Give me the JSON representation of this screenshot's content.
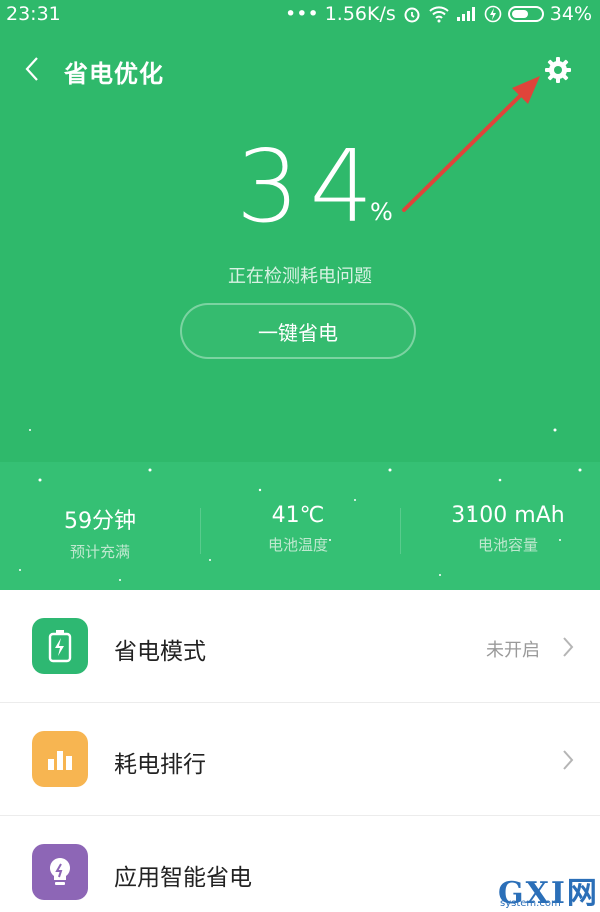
{
  "status_bar": {
    "time": "23:31",
    "speed": "••• 1.56K/s",
    "battery_text": "34%"
  },
  "header": {
    "title": "省电优化",
    "back_icon": "chevron-left-icon",
    "settings_icon": "gear-icon"
  },
  "battery": {
    "percent": "34",
    "percent_sign": "%",
    "detect_text": "正在检测耗电问题",
    "save_button": "一键省电"
  },
  "stats": [
    {
      "value": "59分钟",
      "label": "预计充满"
    },
    {
      "value": "41℃",
      "label": "电池温度"
    },
    {
      "value": "3100 mAh",
      "label": "电池容量"
    }
  ],
  "list": [
    {
      "label": "省电模式",
      "status": "未开启",
      "icon": "battery-charging-icon",
      "color": "#2eb872"
    },
    {
      "label": "耗电排行",
      "status": "",
      "icon": "bar-chart-icon",
      "color": "#f7b551"
    },
    {
      "label": "应用智能省电",
      "status": "",
      "icon": "lightbulb-icon",
      "color": "#8d66b6"
    }
  ],
  "watermark": {
    "main": "GXI网",
    "sub": "system.com"
  },
  "colors": {
    "primary_green": "#2fb96b",
    "arrow_red": "#e0443a"
  }
}
